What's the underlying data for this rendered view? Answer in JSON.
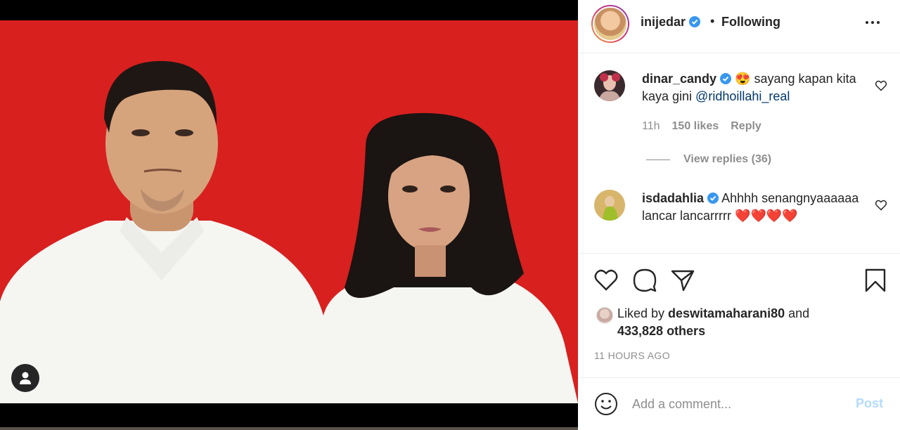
{
  "post": {
    "author": "inijedar",
    "follow_status": "Following",
    "separator": "•"
  },
  "comments": [
    {
      "username": "dinar_candy",
      "emoji": "😍",
      "text": " sayang kapan kita kaya gini ",
      "mention": "@ridhoillahi_real",
      "time": "11h",
      "likes": "150 likes",
      "reply": "Reply",
      "view_replies": "View replies (36)"
    },
    {
      "username": "isdadahlia",
      "text": " Ahhhh senangnyaaaaaa lancar lancarrrrr ",
      "hearts": "❤️❤️❤️❤️"
    }
  ],
  "likes": {
    "prefix": "Liked by ",
    "liker": "deswitamaharani80",
    "and": " and",
    "others": "433,828 others"
  },
  "timestamp": "11 HOURS AGO",
  "composer": {
    "placeholder": "Add a comment...",
    "post_label": "Post"
  },
  "colors": {
    "backdrop": "#d8201f",
    "verified": "#3897f0",
    "link": "#00376b",
    "post_disabled": "#b3dbff"
  },
  "icons": [
    "heart-icon",
    "comment-icon",
    "share-icon",
    "bookmark-icon",
    "emoji-icon",
    "user-tag-icon",
    "more-icon",
    "verified-badge-icon"
  ]
}
